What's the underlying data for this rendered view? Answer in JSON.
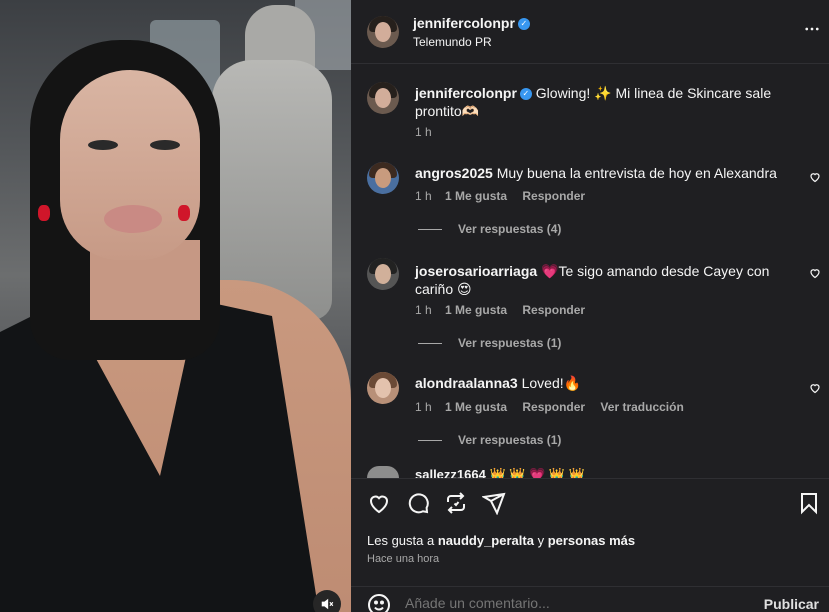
{
  "post": {
    "username": "jennifercolonpr",
    "subtitle": "Telemundo PR",
    "more_icon": "more-horizontal-icon",
    "caption_user": "jennifercolonpr",
    "caption_text": "Glowing! ✨ Mi linea de Skincare sale prontito🫶🏻",
    "caption_time": "1 h"
  },
  "comments": [
    {
      "username": "angros2025",
      "text": "Muy buena la entrevista de hoy en Alexandra",
      "time": "1 h",
      "likes": "1 Me gusta",
      "reply": "Responder",
      "view_replies": "Ver respuestas (4)"
    },
    {
      "username": "joserosarioarriaga",
      "text": "💗Te sigo amando desde Cayey con cariño 😍",
      "time": "1 h",
      "likes": "1 Me gusta",
      "reply": "Responder",
      "view_replies": "Ver respuestas (1)"
    },
    {
      "username": "alondraalanna3",
      "text": "Loved!🔥",
      "time": "1 h",
      "likes": "1 Me gusta",
      "reply": "Responder",
      "translate": "Ver traducción",
      "view_replies": "Ver respuestas (1)"
    }
  ],
  "partial_comment": {
    "username": "sallezz1664",
    "text": "👑 👑 💗 👑 👑"
  },
  "actions": {
    "likes_prefix": "Les gusta a",
    "likes_user": "nauddy_peralta",
    "likes_and": "y",
    "likes_rest": "personas más",
    "time_ago": "Hace una hora"
  },
  "comment_box": {
    "placeholder": "Añade un comentario...",
    "publish_label": "Publicar"
  },
  "colors": {
    "panel_bg": "#1f1f22",
    "verified": "#3897f0",
    "secondary_text": "#a8a8a8"
  }
}
